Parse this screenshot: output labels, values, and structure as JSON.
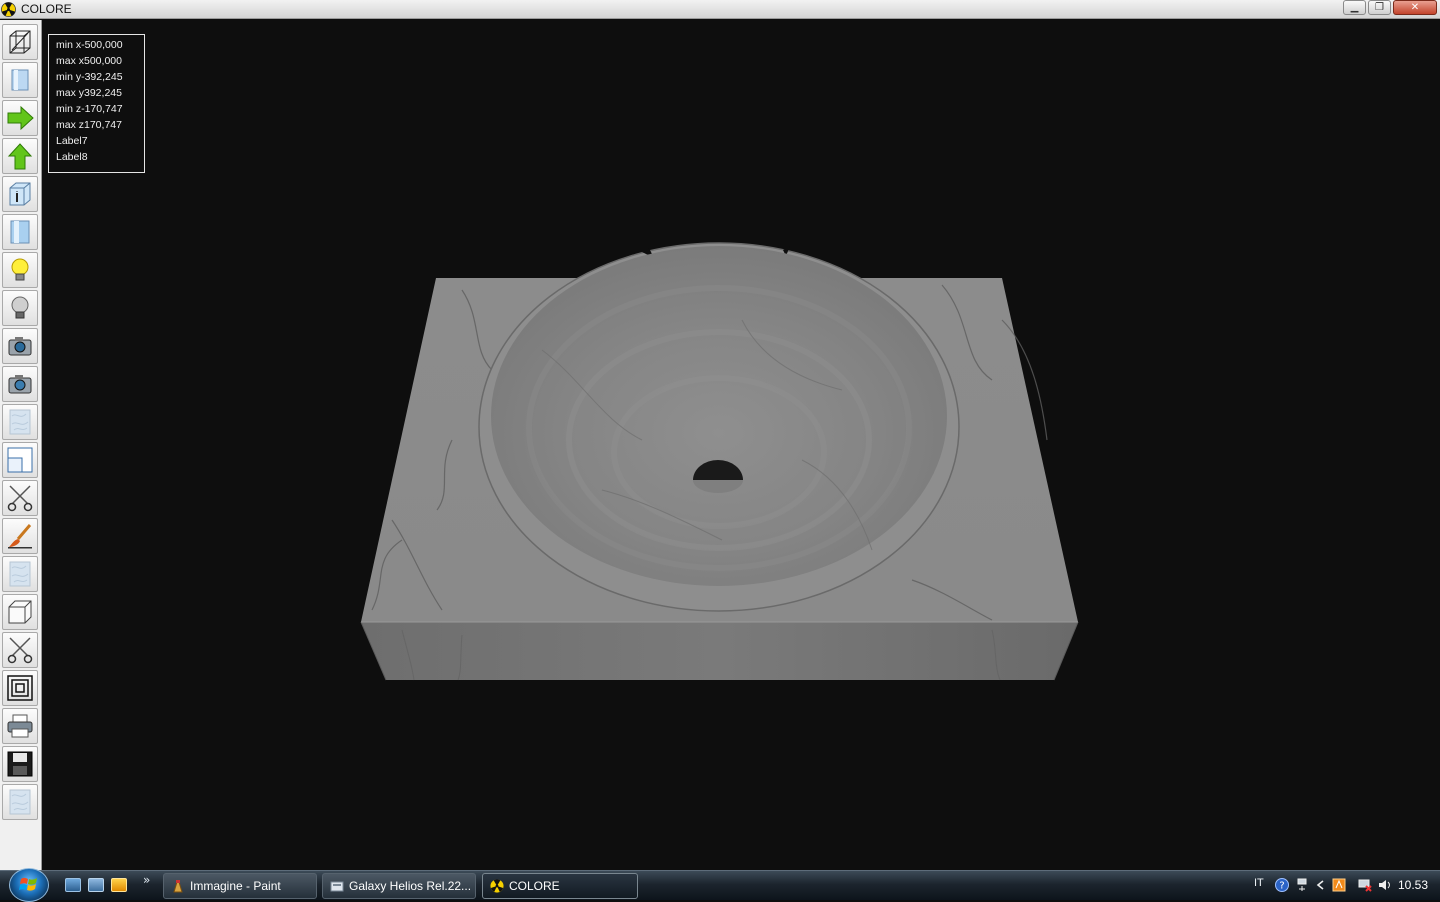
{
  "window": {
    "title": "COLORE",
    "minimize_glyph": "▁",
    "restore_glyph": "❐",
    "close_glyph": "✕"
  },
  "toolbar": {
    "tools": [
      {
        "icon": "wireframe-icon"
      },
      {
        "icon": "solid-panel-icon"
      },
      {
        "icon": "arrow-right-icon"
      },
      {
        "icon": "arrow-up-icon"
      },
      {
        "icon": "info-panel-icon"
      },
      {
        "icon": "glass-panel-icon"
      },
      {
        "icon": "lightbulb-on-icon"
      },
      {
        "icon": "lightbulb-off-icon"
      },
      {
        "icon": "camera-icon"
      },
      {
        "icon": "camera-alt-icon"
      },
      {
        "icon": "texture-disabled-icon"
      },
      {
        "icon": "window-split-icon"
      },
      {
        "icon": "scissors-icon"
      },
      {
        "icon": "paintbrush-icon"
      },
      {
        "icon": "texture-disabled-icon-2"
      },
      {
        "icon": "cube-icon"
      },
      {
        "icon": "scissors-alt-icon"
      },
      {
        "icon": "concentric-squares-icon"
      },
      {
        "icon": "printer-icon"
      },
      {
        "icon": "floppy-disk-icon"
      },
      {
        "icon": "texture-disabled-icon-3"
      }
    ]
  },
  "info": {
    "lines": [
      "min x-500,000",
      "max x500,000",
      "min y-392,245",
      "max y392,245",
      "min z-170,747",
      "max z170,747",
      "Label7",
      "Label8"
    ]
  },
  "taskbar": {
    "quicklaunch_more": "»",
    "tasks": [
      {
        "label": "Immagine - Paint"
      },
      {
        "label": "Galaxy Helios  Rel.22..."
      },
      {
        "label": "COLORE"
      }
    ],
    "language": "IT",
    "clock": "10.53"
  },
  "colors": {
    "viewport_bg": "#0e0e0e",
    "marble": "#8a8a8a",
    "taskbar": "#1c252e"
  }
}
